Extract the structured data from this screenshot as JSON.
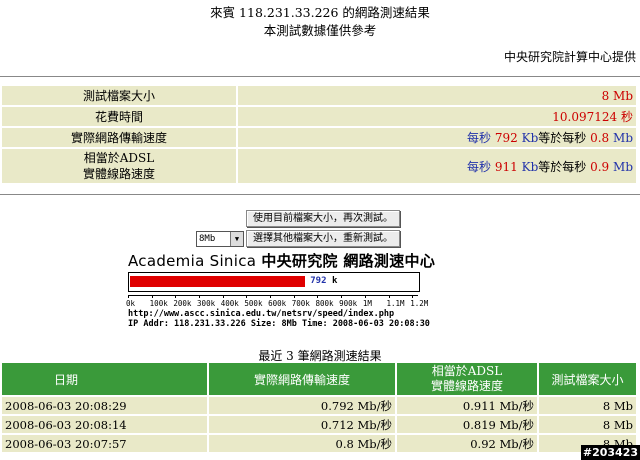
{
  "header": {
    "title": "來賓 118.231.33.226 的網路測速結果",
    "subtitle": "本測試數據僅供參考",
    "provider": "中央研究院計算中心提供"
  },
  "results": {
    "file_size": {
      "label": "測試檔案大小",
      "value": "8",
      "unit": "Mb"
    },
    "time_spent": {
      "label": "花費時間",
      "value": "10.097124",
      "unit": "秒"
    },
    "actual_speed": {
      "label": "實際網路傳輸速度",
      "prefix": "每秒",
      "kb": "792",
      "kb_unit": "Kb",
      "mid": "等於每秒",
      "mb": "0.8",
      "mb_unit": "Mb"
    },
    "adsl_speed": {
      "label_line1": "相當於ADSL",
      "label_line2": "實體線路速度",
      "prefix": "每秒",
      "kb": "911",
      "kb_unit": "Kb",
      "mid": "等於每秒",
      "mb": "0.9",
      "mb_unit": "Mb"
    }
  },
  "controls": {
    "retest_button": "使用目前檔案大小，再次測試。",
    "size_select_value": "8Mb",
    "choose_button": "選擇其他檔案大小，重新測試。"
  },
  "banner": {
    "english": "Academia Sinica",
    "chinese": "中央研究院 網路測速中心"
  },
  "speed_bar": {
    "value_kb": 792,
    "max_kb": 1200,
    "label": "792",
    "unit": "k",
    "ticks": [
      "0k",
      "100k",
      "200k",
      "300k",
      "400k",
      "500k",
      "600k",
      "700k",
      "800k",
      "900k",
      "1M",
      "1.1M",
      "1.2M"
    ]
  },
  "info": {
    "url": "http://www.ascc.sinica.edu.tw/netsrv/speed/index.php",
    "ip_line": "IP Addr: 118.231.33.226 Size: 8Mb Time: 2008-06-03 20:08:30"
  },
  "history": {
    "title": "最近 3 筆網路測速結果",
    "headers": {
      "date": "日期",
      "speed": "實際網路傳輸速度",
      "adsl_line1": "相當於ADSL",
      "adsl_line2": "實體線路速度",
      "size": "測試檔案大小"
    },
    "rows": [
      {
        "date": "2008-06-03 20:08:29",
        "speed": "0.792 Mb/秒",
        "adsl": "0.911 Mb/秒",
        "size": "8 Mb"
      },
      {
        "date": "2008-06-03 20:08:14",
        "speed": "0.712 Mb/秒",
        "adsl": "0.819 Mb/秒",
        "size": "8 Mb"
      },
      {
        "date": "2008-06-03 20:07:57",
        "speed": "0.8 Mb/秒",
        "adsl": "0.92 Mb/秒",
        "size": "8 Mb"
      }
    ]
  },
  "watermark": "#203423"
}
